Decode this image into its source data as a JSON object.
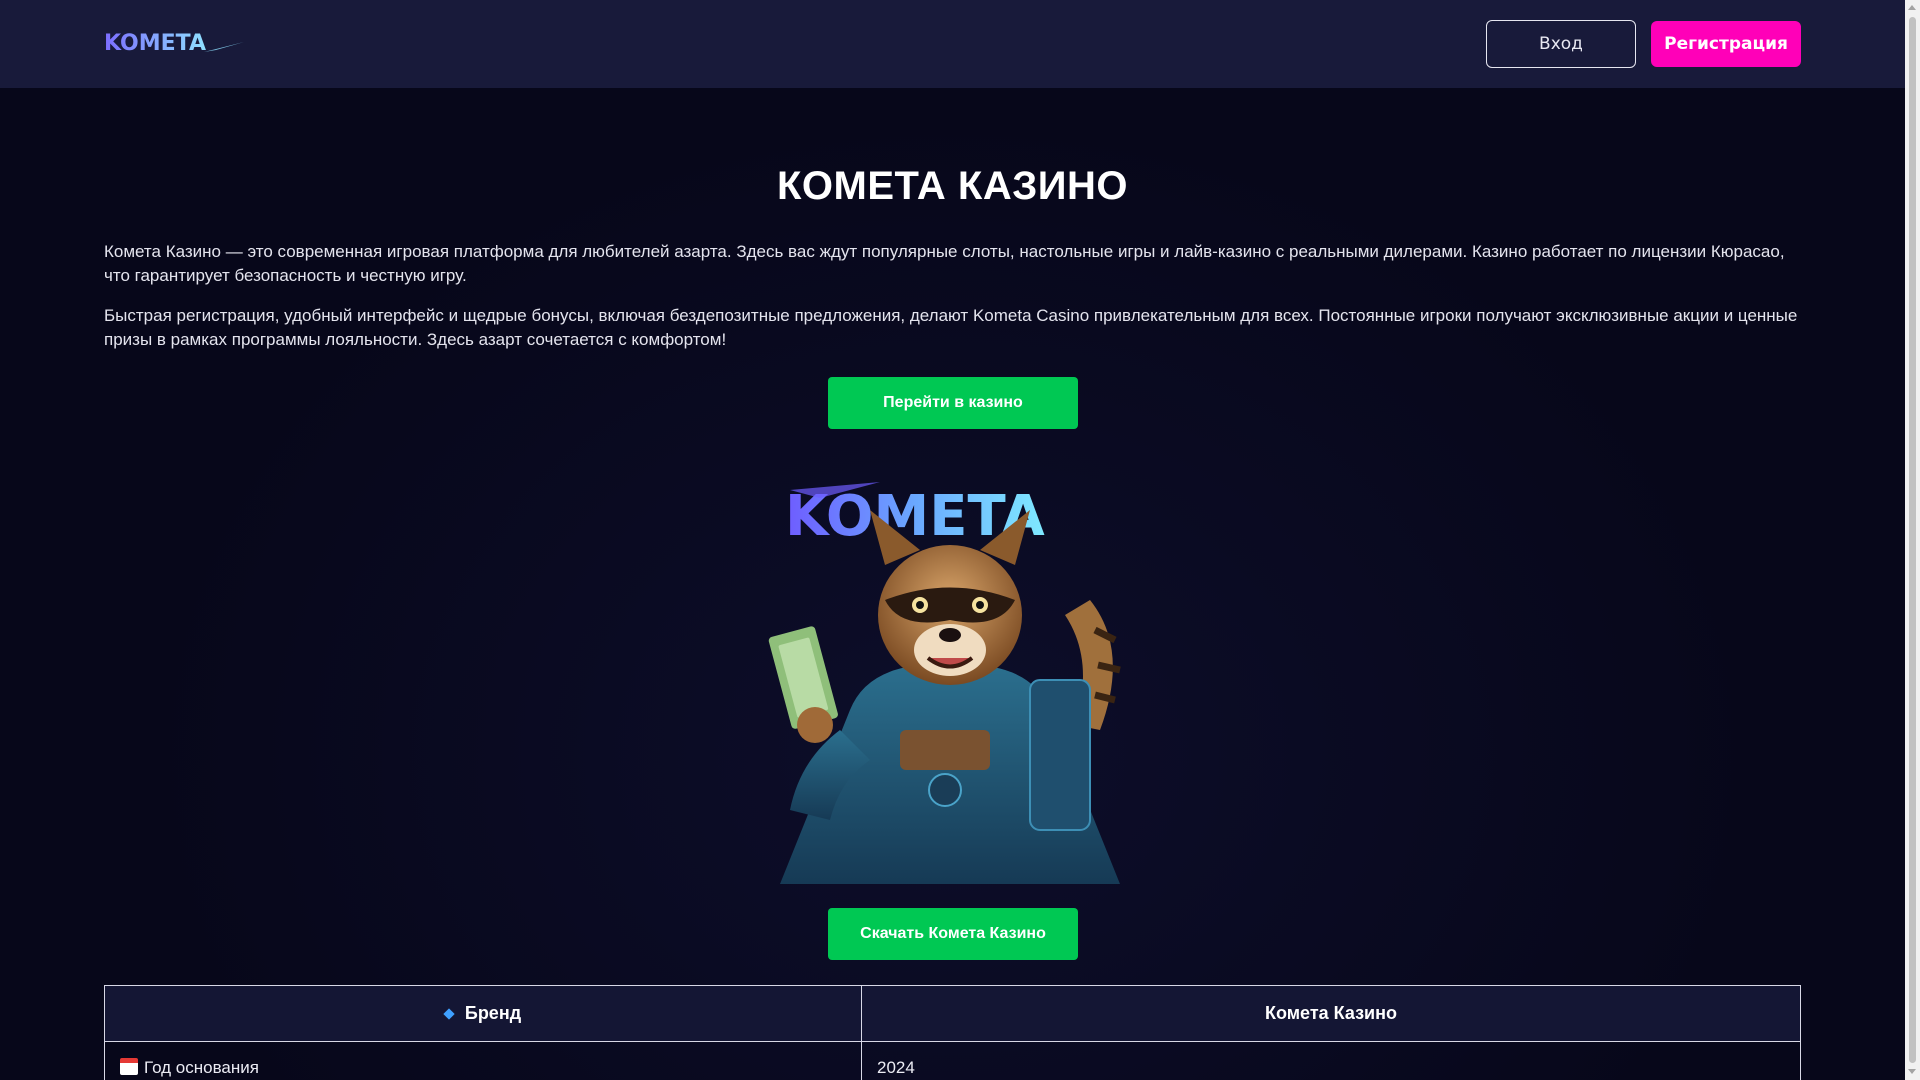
{
  "header": {
    "logo_text": "KOMETA",
    "login_label": "Вход",
    "register_label": "Регистрация"
  },
  "main": {
    "title": "КОМЕТА КАЗИНО",
    "paragraph_1": "Комета Казино — это современная игровая платформа для любителей азарта. Здесь вас ждут популярные слоты, настольные игры и лайв-казино с реальными дилерами. Казино работает по лицензии Кюрасао, что гарантирует безопасность и честную игру.",
    "paragraph_2": "Быстрая регистрация, удобный интерфейс и щедрые бонусы, включая бездепозитные предложения, делают Kometa Casino привлекательным для всех. Постоянные игроки получают эксклюзивные акции и ценные призы в рамках программы лояльности. Здесь азарт сочетается с комфортом!",
    "go_button_label": "Перейти в казино",
    "hero_logo_text": "KOMETA",
    "download_button_label": "Скачать Комета Казино"
  },
  "table": {
    "header_left": "Бренд",
    "header_right": "Комета Казино",
    "rows": [
      {
        "label": "Год основания",
        "value": "2024"
      }
    ]
  },
  "colors": {
    "background": "#07071a",
    "header_bg": "#181a3a",
    "accent_pink": "#ff00b8",
    "accent_green": "#00c853",
    "logo_gradient_start": "#7b5cff",
    "logo_gradient_end": "#7fe3ff"
  },
  "icons": {
    "brand_row": "blue-diamond-icon",
    "year_row": "calendar-icon"
  }
}
